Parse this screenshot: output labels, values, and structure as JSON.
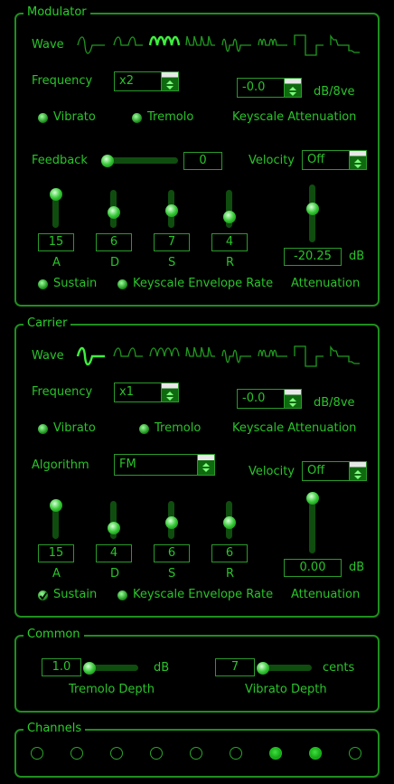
{
  "modulator": {
    "title": "Modulator",
    "wave_label": "Wave",
    "waves": [
      "sine-wave-icon",
      "half-sine-wave-icon",
      "abs-sine-wave-icon",
      "pulse-sine-wave-icon",
      "sine-even-periods-wave-icon",
      "abs-sine-even-periods-wave-icon",
      "square-wave-icon",
      "derived-square-wave-icon"
    ],
    "selected_wave": 2,
    "frequency_label": "Frequency",
    "frequency_value": "x2",
    "ksl_value": "-0.0",
    "ksl_unit": "dB/8ve",
    "vibrato_label": "Vibrato",
    "tremolo_label": "Tremolo",
    "ksl_label": "Keyscale Attenuation",
    "feedback_label": "Feedback",
    "feedback_value": "0",
    "velocity_label": "Velocity",
    "velocity_value": "Off",
    "env": [
      {
        "label": "A",
        "value": "15"
      },
      {
        "label": "D",
        "value": "6"
      },
      {
        "label": "S",
        "value": "7"
      },
      {
        "label": "R",
        "value": "4"
      }
    ],
    "attenuation_value": "-20.25",
    "attenuation_unit": "dB",
    "attenuation_label": "Attenuation",
    "sustain_label": "Sustain",
    "ker_label": "Keyscale Envelope Rate"
  },
  "carrier": {
    "title": "Carrier",
    "wave_label": "Wave",
    "waves": [
      "sine-wave-icon",
      "half-sine-wave-icon",
      "abs-sine-wave-icon",
      "pulse-sine-wave-icon",
      "sine-even-periods-wave-icon",
      "abs-sine-even-periods-wave-icon",
      "square-wave-icon",
      "derived-square-wave-icon"
    ],
    "selected_wave": 0,
    "frequency_label": "Frequency",
    "frequency_value": "x1",
    "ksl_value": "-0.0",
    "ksl_unit": "dB/8ve",
    "vibrato_label": "Vibrato",
    "tremolo_label": "Tremolo",
    "ksl_label": "Keyscale Attenuation",
    "algorithm_label": "Algorithm",
    "algorithm_value": "FM",
    "velocity_label": "Velocity",
    "velocity_value": "Off",
    "env": [
      {
        "label": "A",
        "value": "15"
      },
      {
        "label": "D",
        "value": "4"
      },
      {
        "label": "S",
        "value": "6"
      },
      {
        "label": "R",
        "value": "6"
      }
    ],
    "attenuation_value": "0.00",
    "attenuation_unit": "dB",
    "attenuation_label": "Attenuation",
    "sustain_label": "Sustain",
    "ker_label": "Keyscale Envelope Rate"
  },
  "common": {
    "title": "Common",
    "tremolo_depth_value": "1.0",
    "tremolo_depth_unit": "dB",
    "tremolo_depth_label": "Tremolo Depth",
    "vibrato_depth_value": "7",
    "vibrato_depth_unit": "cents",
    "vibrato_depth_label": "Vibrato Depth"
  },
  "channels": {
    "title": "Channels",
    "states": [
      false,
      false,
      false,
      false,
      false,
      false,
      true,
      true,
      false
    ]
  },
  "colors": {
    "accent": "#29c429",
    "border": "#1e8f1e",
    "background": "#000000"
  }
}
